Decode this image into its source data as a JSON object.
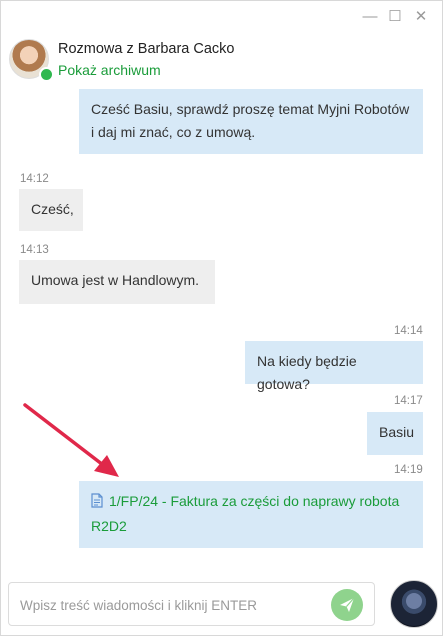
{
  "window": {
    "controls": {
      "minimize": "—",
      "maximize": "☐",
      "close": "✕"
    }
  },
  "header": {
    "title": "Rozmowa z Barbara Cacko",
    "archive_link": "Pokaż archiwum"
  },
  "messages": [
    {
      "direction": "out",
      "time": "",
      "text": "Cześć Basiu, sprawdź proszę temat Myjni Robotów i daj mi znać, co z umową."
    },
    {
      "direction": "in",
      "time": "14:12",
      "text": "Cześć,"
    },
    {
      "direction": "in",
      "time": "14:13",
      "text": "Umowa jest w Handlowym."
    },
    {
      "direction": "out",
      "time": "14:14",
      "text": "Na kiedy będzie gotowa?"
    },
    {
      "direction": "out",
      "time": "14:17",
      "text": "Basiu"
    },
    {
      "direction": "out",
      "time": "14:19",
      "file_icon": "document-icon",
      "text": "1/FP/24 - Faktura za części do naprawy robota R2D2"
    }
  ],
  "composer": {
    "placeholder": "Wpisz treść wiadomości i kliknij ENTER",
    "send_icon": "send-icon"
  },
  "colors": {
    "accent_green": "#1a9c3a",
    "outgoing_bubble": "#d7e9f7",
    "incoming_bubble": "#eeeeee",
    "arrow": "#e0284a",
    "send_button": "#8fd38d"
  }
}
